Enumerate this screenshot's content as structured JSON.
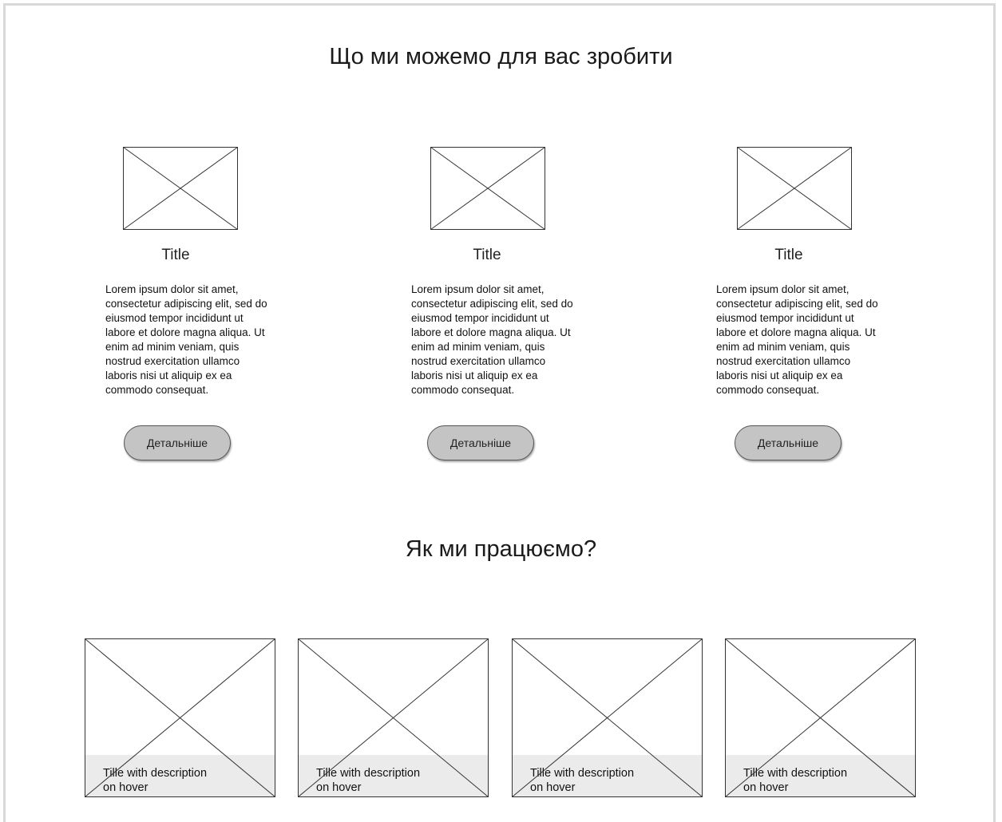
{
  "services": {
    "heading": "Що ми можемо для вас зробити",
    "cards": [
      {
        "title": "Title",
        "body": "Lorem ipsum dolor sit amet, consectetur adipiscing elit, sed do eiusmod tempor incididunt ut labore et dolore magna aliqua. Ut enim ad minim veniam, quis nostrud exercitation ullamco laboris nisi ut aliquip ex ea commodo consequat.",
        "button_label": "Детальніше"
      },
      {
        "title": "Title",
        "body": "Lorem ipsum dolor sit amet, consectetur adipiscing elit, sed do eiusmod tempor incididunt ut labore et dolore magna aliqua. Ut enim ad minim veniam, quis nostrud exercitation ullamco laboris nisi ut aliquip ex ea commodo consequat.",
        "button_label": "Детальніше"
      },
      {
        "title": "Title",
        "body": "Lorem ipsum dolor sit amet, consectetur adipiscing elit, sed do eiusmod tempor incididunt ut labore et dolore magna aliqua. Ut enim ad minim veniam, quis nostrud exercitation ullamco laboris nisi ut aliquip ex ea commodo consequat.",
        "button_label": "Детальніше"
      }
    ]
  },
  "process": {
    "heading": "Як ми працюємо?",
    "steps": [
      {
        "caption_line1": "Tille with description",
        "caption_line2": "on hover"
      },
      {
        "caption_line1": "Tille with description",
        "caption_line2": "on hover"
      },
      {
        "caption_line1": "Tille with description",
        "caption_line2": "on hover"
      },
      {
        "caption_line1": "Tille with description",
        "caption_line2": "on hover"
      }
    ]
  },
  "colors": {
    "button_fill": "#c4c4c4",
    "caption_overlay": "#e2e2e2",
    "frame_border": "#d9d9d9"
  },
  "icons": {
    "placeholder": "image-placeholder-icon"
  }
}
